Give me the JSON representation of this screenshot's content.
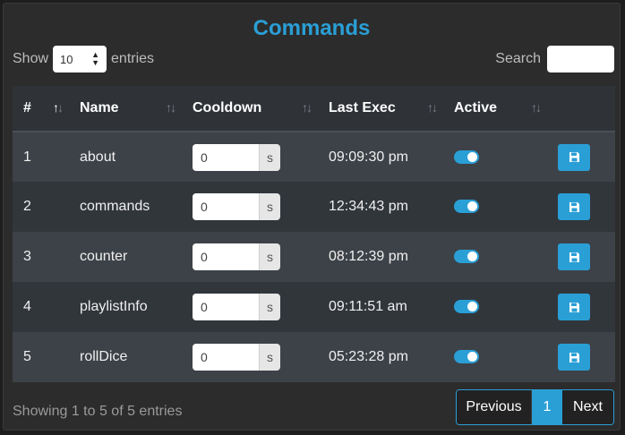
{
  "title": "Commands",
  "length": {
    "label_before": "Show",
    "value": "10",
    "label_after": "entries"
  },
  "search": {
    "label": "Search",
    "value": ""
  },
  "columns": [
    "#",
    "Name",
    "Cooldown",
    "Last Exec",
    "Active"
  ],
  "rows": [
    {
      "num": "1",
      "name": "about",
      "cooldown": "0",
      "unit": "s",
      "last": "09:09:30 pm",
      "active": true
    },
    {
      "num": "2",
      "name": "commands",
      "cooldown": "0",
      "unit": "s",
      "last": "12:34:43 pm",
      "active": true
    },
    {
      "num": "3",
      "name": "counter",
      "cooldown": "0",
      "unit": "s",
      "last": "08:12:39 pm",
      "active": true
    },
    {
      "num": "4",
      "name": "playlistInfo",
      "cooldown": "0",
      "unit": "s",
      "last": "09:11:51 am",
      "active": true
    },
    {
      "num": "5",
      "name": "rollDice",
      "cooldown": "0",
      "unit": "s",
      "last": "05:23:28 pm",
      "active": true
    }
  ],
  "info": "Showing 1 to 5 of 5 entries",
  "pagination": {
    "previous": "Previous",
    "current": "1",
    "next": "Next"
  },
  "colors": {
    "accent": "#2a9fd6",
    "background": "#2c2c2c"
  }
}
